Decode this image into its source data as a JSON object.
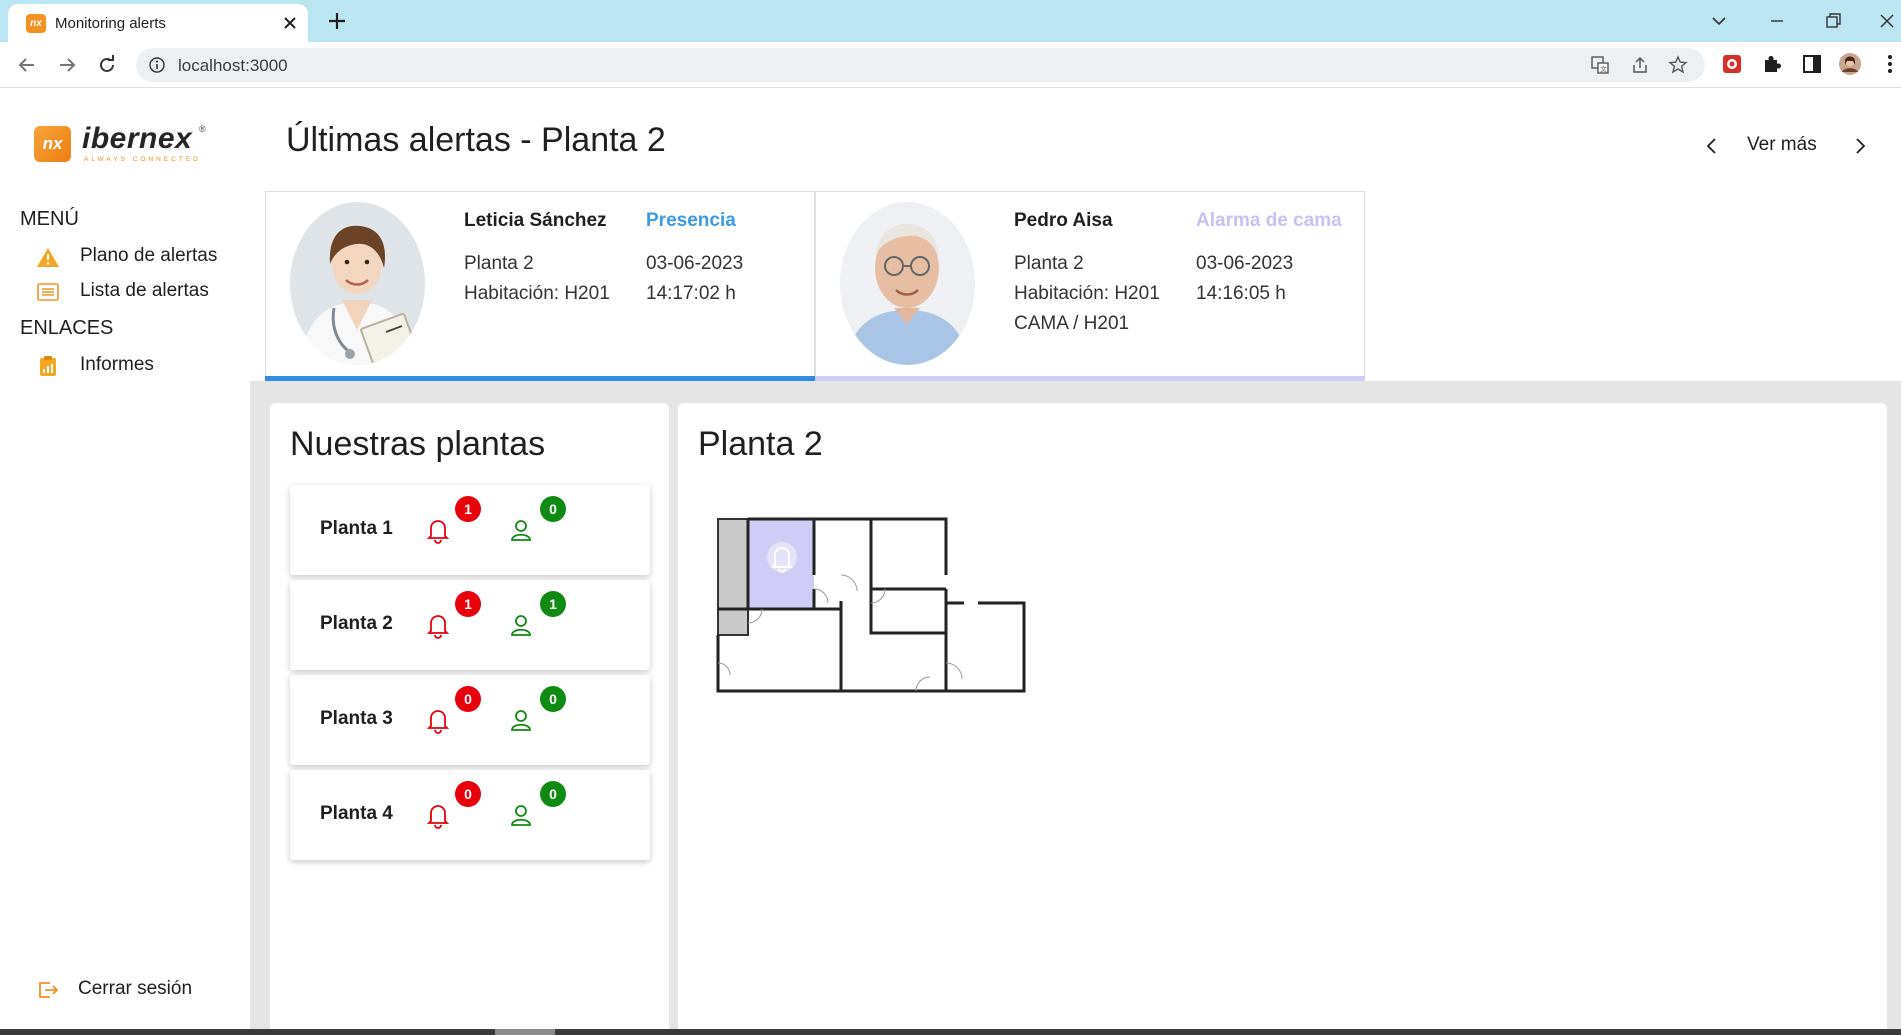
{
  "browser": {
    "tab_title": "Monitoring alerts",
    "favicon_text": "nx",
    "url": "localhost:3000"
  },
  "brand": {
    "badge": "nx",
    "name": "ibernex",
    "tagline": "ALWAYS CONNECTED",
    "reg": "®",
    "color": "#f39322"
  },
  "sidebar": {
    "menu_title": "MENÚ",
    "menu_items": [
      {
        "label": "Plano de alertas",
        "icon": "warning-icon"
      },
      {
        "label": "Lista de alertas",
        "icon": "list-icon"
      }
    ],
    "links_title": "ENLACES",
    "link_items": [
      {
        "label": "Informes",
        "icon": "clipboard-icon"
      }
    ],
    "logout_label": "Cerrar sesión"
  },
  "header": {
    "title": "Últimas alertas - Planta 2",
    "pager_label": "Ver más"
  },
  "alerts": [
    {
      "name": "Leticia Sánchez",
      "type": "Presencia",
      "type_color": "#3b9be3",
      "floor": "Planta 2",
      "room": "Habitación: H201",
      "date": "03-06-2023",
      "time": "14:17:02 h",
      "extra": "",
      "underline_color": "#2f8ee0"
    },
    {
      "name": "Pedro Aisa",
      "type": "Alarma de cama",
      "type_color": "#c6c2f2",
      "floor": "Planta 2",
      "room": "Habitación: H201",
      "date": "03-06-2023",
      "time": "14:16:05 h",
      "extra": "CAMA / H201",
      "underline_color": "#cfcdf5"
    }
  ],
  "plants_panel": {
    "title": "Nuestras plantas",
    "plants": [
      {
        "name": "Planta 1",
        "alerts": "1",
        "presence": "0"
      },
      {
        "name": "Planta 2",
        "alerts": "1",
        "presence": "1"
      },
      {
        "name": "Planta 3",
        "alerts": "0",
        "presence": "0"
      },
      {
        "name": "Planta 4",
        "alerts": "0",
        "presence": "0"
      }
    ]
  },
  "map_panel": {
    "title": "Planta 2",
    "highlight_color": "#cfcdf5"
  },
  "colors": {
    "alert_red": "#e8000b",
    "presence_green": "#0f8a12",
    "accent_orange": "#f39322"
  }
}
